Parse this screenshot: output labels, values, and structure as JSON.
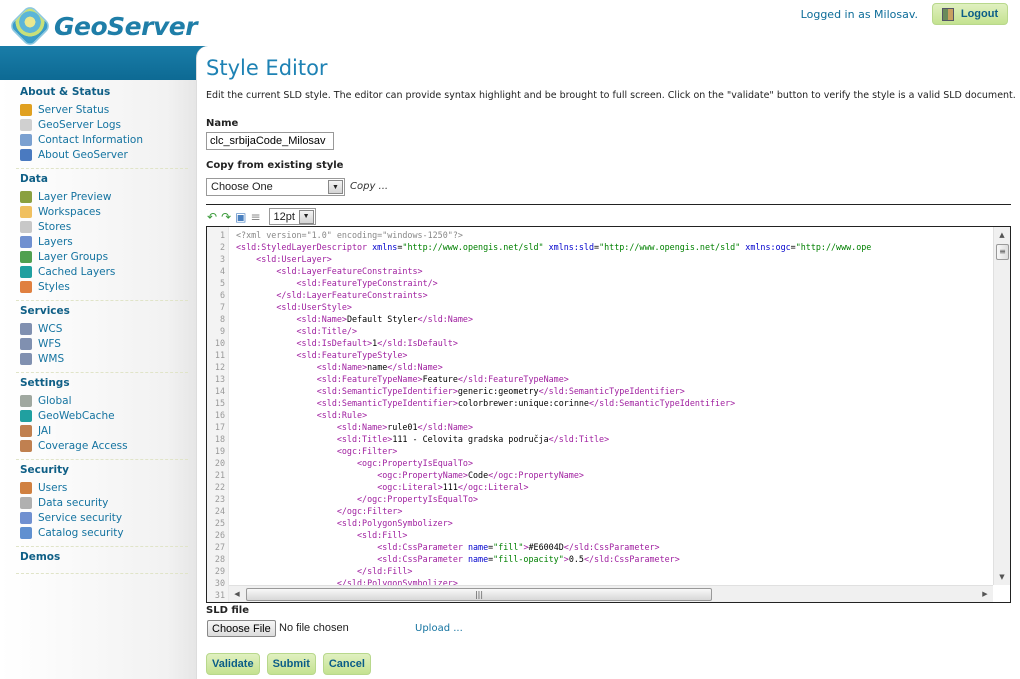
{
  "header": {
    "app_name": "GeoServer",
    "logged_in_text": "Logged in as Milosav.",
    "logout_label": "Logout"
  },
  "sidebar": {
    "sections": [
      {
        "title": "About & Status",
        "items": [
          {
            "label": "Server Status",
            "icon": "server-status-icon",
            "color": "#e0a020"
          },
          {
            "label": "GeoServer Logs",
            "icon": "log-document-icon",
            "color": "#d0d0d0"
          },
          {
            "label": "Contact Information",
            "icon": "contact-card-icon",
            "color": "#7aa0d0"
          },
          {
            "label": "About GeoServer",
            "icon": "info-icon",
            "color": "#4a7ac0"
          }
        ]
      },
      {
        "title": "Data",
        "items": [
          {
            "label": "Layer Preview",
            "icon": "layer-preview-icon",
            "color": "#8aa040"
          },
          {
            "label": "Workspaces",
            "icon": "folder-icon",
            "color": "#f0c060"
          },
          {
            "label": "Stores",
            "icon": "database-icon",
            "color": "#c8c8c8"
          },
          {
            "label": "Layers",
            "icon": "layers-icon",
            "color": "#7090d0"
          },
          {
            "label": "Layer Groups",
            "icon": "layer-groups-icon",
            "color": "#50a050"
          },
          {
            "label": "Cached Layers",
            "icon": "globe-cache-icon",
            "color": "#20a0a0"
          },
          {
            "label": "Styles",
            "icon": "palette-icon",
            "color": "#e08040"
          }
        ]
      },
      {
        "title": "Services",
        "items": [
          {
            "label": "WCS",
            "icon": "wcs-service-icon",
            "color": "#8090b0"
          },
          {
            "label": "WFS",
            "icon": "wfs-service-icon",
            "color": "#8090b0"
          },
          {
            "label": "WMS",
            "icon": "wms-service-icon",
            "color": "#8090b0"
          }
        ]
      },
      {
        "title": "Settings",
        "items": [
          {
            "label": "Global",
            "icon": "server-icon",
            "color": "#a0a8a0"
          },
          {
            "label": "GeoWebCache",
            "icon": "globe-cache-icon",
            "color": "#20a0a0"
          },
          {
            "label": "JAI",
            "icon": "image-settings-icon",
            "color": "#c08050"
          },
          {
            "label": "Coverage Access",
            "icon": "image-settings-icon",
            "color": "#c08050"
          }
        ]
      },
      {
        "title": "Security",
        "items": [
          {
            "label": "Users",
            "icon": "user-icon",
            "color": "#d08040"
          },
          {
            "label": "Data security",
            "icon": "data-key-icon",
            "color": "#b0b0b0"
          },
          {
            "label": "Service security",
            "icon": "service-key-icon",
            "color": "#7090d0"
          },
          {
            "label": "Catalog security",
            "icon": "catalog-key-icon",
            "color": "#6090d0"
          }
        ]
      },
      {
        "title": "Demos",
        "items": []
      }
    ]
  },
  "main": {
    "title": "Style Editor",
    "description": "Edit the current SLD style. The editor can provide syntax highlight and be brought to full screen. Click on the \"validate\" button to verify the style is a valid SLD document.",
    "name_label": "Name",
    "name_value": "clc_srbijaCode_Milosav",
    "copy_label": "Copy from existing style",
    "copy_select_value": "Choose One",
    "copy_link": "Copy ...",
    "font_size": "12pt",
    "toolbar_icons": [
      "undo-icon",
      "redo-icon",
      "goto-line-icon",
      "reformat-icon"
    ],
    "code_lines": [
      [
        [
          "pi",
          "<?xml version=\"1.0\" encoding=\"windows-1250\"?>"
        ]
      ],
      [
        [
          "tag",
          "<sld:StyledLayerDescriptor "
        ],
        [
          "attr",
          "xmlns"
        ],
        [
          "",
          "="
        ],
        [
          "val",
          "\"http://www.opengis.net/sld\""
        ],
        [
          "attr",
          " xmlns:sld"
        ],
        [
          "",
          "="
        ],
        [
          "val",
          "\"http://www.opengis.net/sld\""
        ],
        [
          "attr",
          " xmlns:ogc"
        ],
        [
          "",
          "="
        ],
        [
          "val",
          "\"http://www.ope"
        ]
      ],
      [
        [
          "",
          "    "
        ],
        [
          "tag",
          "<sld:UserLayer>"
        ]
      ],
      [
        [
          "",
          "        "
        ],
        [
          "tag",
          "<sld:LayerFeatureConstraints>"
        ]
      ],
      [
        [
          "",
          "            "
        ],
        [
          "tag",
          "<sld:FeatureTypeConstraint/>"
        ]
      ],
      [
        [
          "",
          "        "
        ],
        [
          "tag",
          "</sld:LayerFeatureConstraints>"
        ]
      ],
      [
        [
          "",
          "        "
        ],
        [
          "tag",
          "<sld:UserStyle>"
        ]
      ],
      [
        [
          "",
          "            "
        ],
        [
          "tag",
          "<sld:Name>"
        ],
        [
          "",
          "Default Styler"
        ],
        [
          "tag",
          "</sld:Name>"
        ]
      ],
      [
        [
          "",
          "            "
        ],
        [
          "tag",
          "<sld:Title/>"
        ]
      ],
      [
        [
          "",
          "            "
        ],
        [
          "tag",
          "<sld:IsDefault>"
        ],
        [
          "",
          "1"
        ],
        [
          "tag",
          "</sld:IsDefault>"
        ]
      ],
      [
        [
          "",
          "            "
        ],
        [
          "tag",
          "<sld:FeatureTypeStyle>"
        ]
      ],
      [
        [
          "",
          "                "
        ],
        [
          "tag",
          "<sld:Name>"
        ],
        [
          "",
          "name"
        ],
        [
          "tag",
          "</sld:Name>"
        ]
      ],
      [
        [
          "",
          "                "
        ],
        [
          "tag",
          "<sld:FeatureTypeName>"
        ],
        [
          "",
          "Feature"
        ],
        [
          "tag",
          "</sld:FeatureTypeName>"
        ]
      ],
      [
        [
          "",
          "                "
        ],
        [
          "tag",
          "<sld:SemanticTypeIdentifier>"
        ],
        [
          "",
          "generic:geometry"
        ],
        [
          "tag",
          "</sld:SemanticTypeIdentifier>"
        ]
      ],
      [
        [
          "",
          "                "
        ],
        [
          "tag",
          "<sld:SemanticTypeIdentifier>"
        ],
        [
          "",
          "colorbrewer:unique:corinne"
        ],
        [
          "tag",
          "</sld:SemanticTypeIdentifier>"
        ]
      ],
      [
        [
          "",
          "                "
        ],
        [
          "tag",
          "<sld:Rule>"
        ]
      ],
      [
        [
          "",
          "                    "
        ],
        [
          "tag",
          "<sld:Name>"
        ],
        [
          "",
          "rule01"
        ],
        [
          "tag",
          "</sld:Name>"
        ]
      ],
      [
        [
          "",
          "                    "
        ],
        [
          "tag",
          "<sld:Title>"
        ],
        [
          "",
          "111 - Celovita gradska područja"
        ],
        [
          "tag",
          "</sld:Title>"
        ]
      ],
      [
        [
          "",
          "                    "
        ],
        [
          "tag",
          "<ogc:Filter>"
        ]
      ],
      [
        [
          "",
          "                        "
        ],
        [
          "tag",
          "<ogc:PropertyIsEqualTo>"
        ]
      ],
      [
        [
          "",
          "                            "
        ],
        [
          "tag",
          "<ogc:PropertyName>"
        ],
        [
          "",
          "Code"
        ],
        [
          "tag",
          "</ogc:PropertyName>"
        ]
      ],
      [
        [
          "",
          "                            "
        ],
        [
          "tag",
          "<ogc:Literal>"
        ],
        [
          "",
          "111"
        ],
        [
          "tag",
          "</ogc:Literal>"
        ]
      ],
      [
        [
          "",
          "                        "
        ],
        [
          "tag",
          "</ogc:PropertyIsEqualTo>"
        ]
      ],
      [
        [
          "",
          "                    "
        ],
        [
          "tag",
          "</ogc:Filter>"
        ]
      ],
      [
        [
          "",
          "                    "
        ],
        [
          "tag",
          "<sld:PolygonSymbolizer>"
        ]
      ],
      [
        [
          "",
          "                        "
        ],
        [
          "tag",
          "<sld:Fill>"
        ]
      ],
      [
        [
          "",
          "                            "
        ],
        [
          "tag",
          "<sld:CssParameter "
        ],
        [
          "attr",
          "name"
        ],
        [
          "",
          "="
        ],
        [
          "val",
          "\"fill\""
        ],
        [
          "tag",
          ">"
        ],
        [
          "",
          "#E6004D"
        ],
        [
          "tag",
          "</sld:CssParameter>"
        ]
      ],
      [
        [
          "",
          "                            "
        ],
        [
          "tag",
          "<sld:CssParameter "
        ],
        [
          "attr",
          "name"
        ],
        [
          "",
          "="
        ],
        [
          "val",
          "\"fill-opacity\""
        ],
        [
          "tag",
          ">"
        ],
        [
          "",
          "0.5"
        ],
        [
          "tag",
          "</sld:CssParameter>"
        ]
      ],
      [
        [
          "",
          "                        "
        ],
        [
          "tag",
          "</sld:Fill>"
        ]
      ],
      [
        [
          "",
          "                    "
        ],
        [
          "tag",
          "</sld:PolygonSymbolizer>"
        ]
      ],
      [
        [
          "",
          ""
        ]
      ]
    ],
    "sld_file_label": "SLD file",
    "choose_file_label": "Choose File",
    "no_file_text": "No file chosen",
    "upload_link": "Upload ...",
    "actions": {
      "validate": "Validate",
      "submit": "Submit",
      "cancel": "Cancel"
    }
  }
}
